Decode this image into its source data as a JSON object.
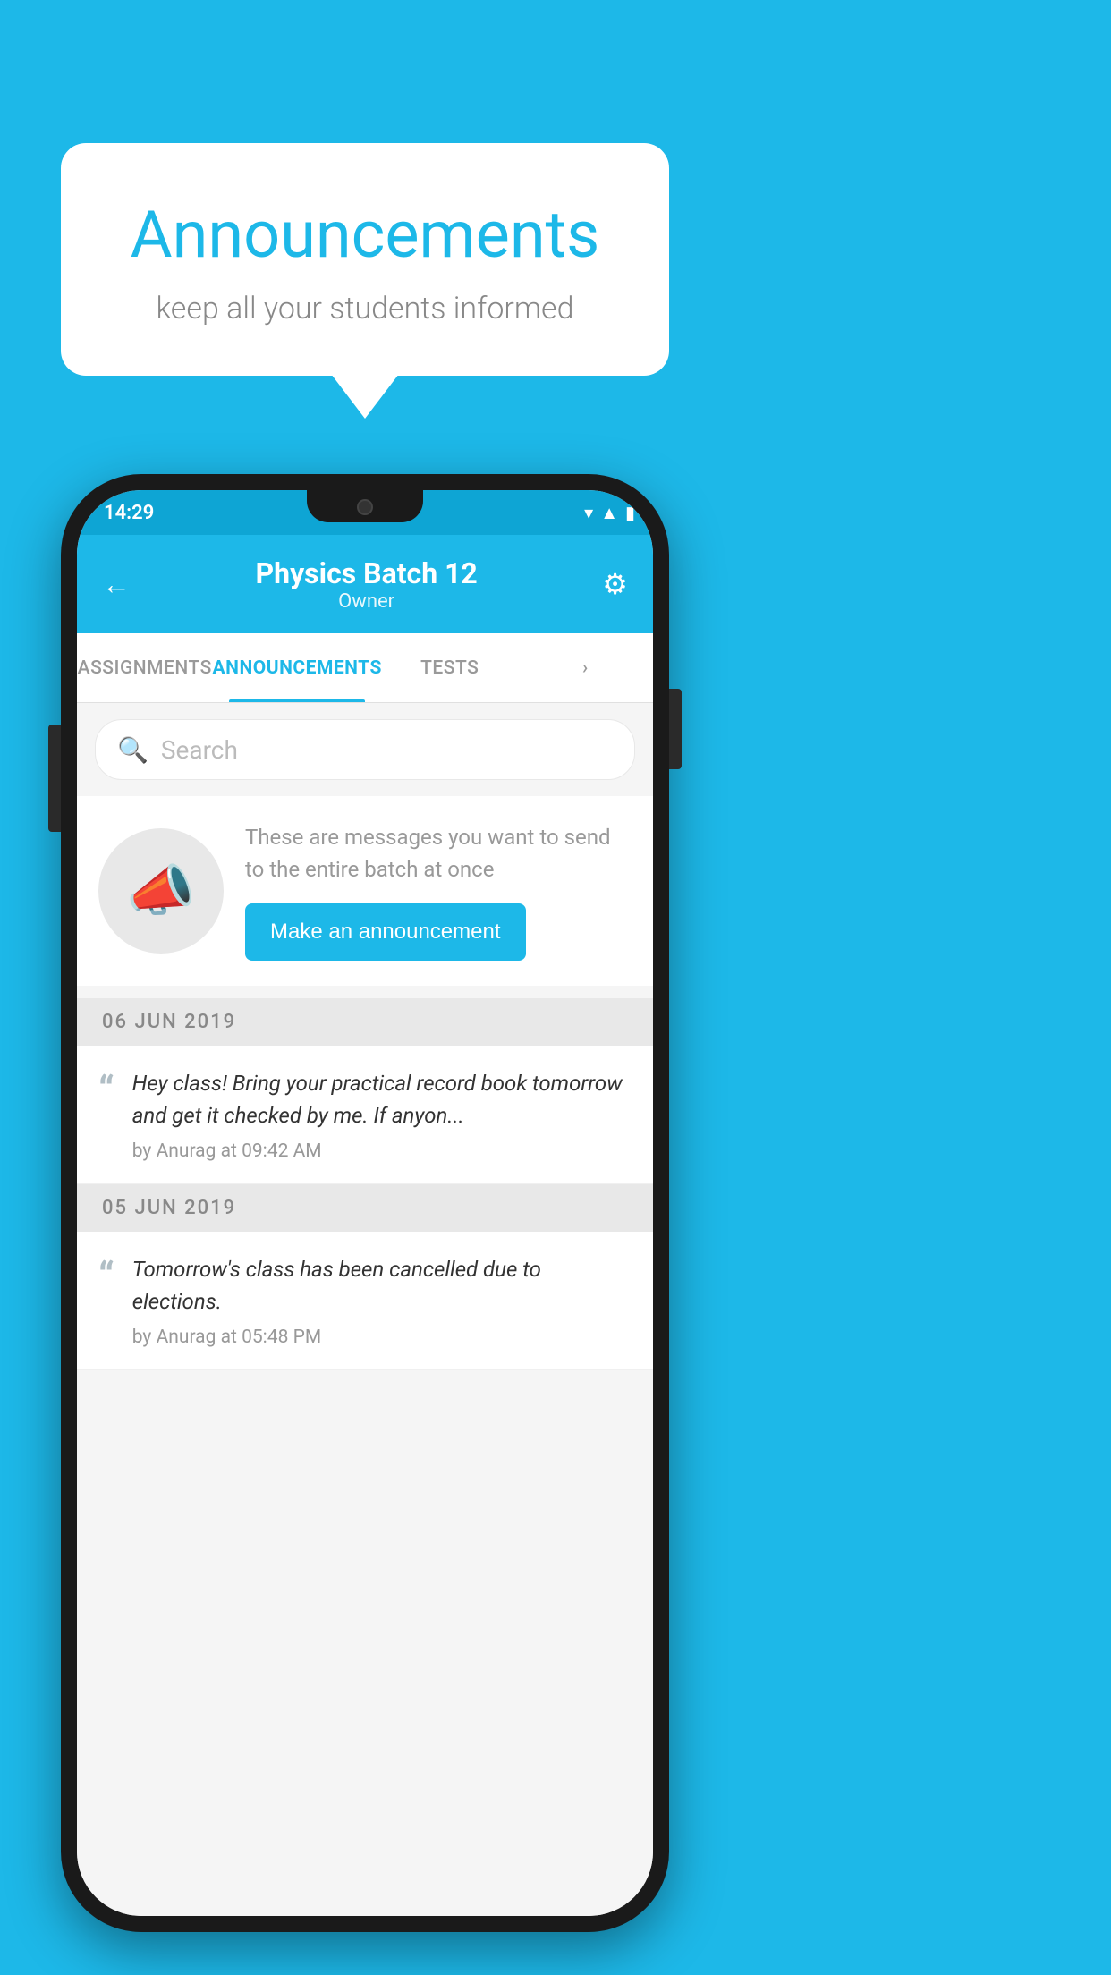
{
  "background_color": "#1db8e8",
  "speech_bubble": {
    "title": "Announcements",
    "subtitle": "keep all your students informed"
  },
  "status_bar": {
    "time": "14:29",
    "wifi": "▾",
    "signal": "▲",
    "battery": "▮"
  },
  "header": {
    "title": "Physics Batch 12",
    "subtitle": "Owner",
    "back_label": "←",
    "settings_label": "⚙"
  },
  "tabs": [
    {
      "label": "ASSIGNMENTS",
      "active": false
    },
    {
      "label": "ANNOUNCEMENTS",
      "active": true
    },
    {
      "label": "TESTS",
      "active": false
    },
    {
      "label": "·",
      "active": false
    }
  ],
  "search": {
    "placeholder": "Search"
  },
  "announcement_prompt": {
    "description": "These are messages you want to send to the entire batch at once",
    "button_label": "Make an announcement"
  },
  "date_sections": [
    {
      "date": "06  JUN  2019",
      "announcements": [
        {
          "text": "Hey class! Bring your practical record book tomorrow and get it checked by me. If anyon...",
          "meta": "by Anurag at 09:42 AM"
        }
      ]
    },
    {
      "date": "05  JUN  2019",
      "announcements": [
        {
          "text": "Tomorrow's class has been cancelled due to elections.",
          "meta": "by Anurag at 05:48 PM"
        }
      ]
    }
  ]
}
